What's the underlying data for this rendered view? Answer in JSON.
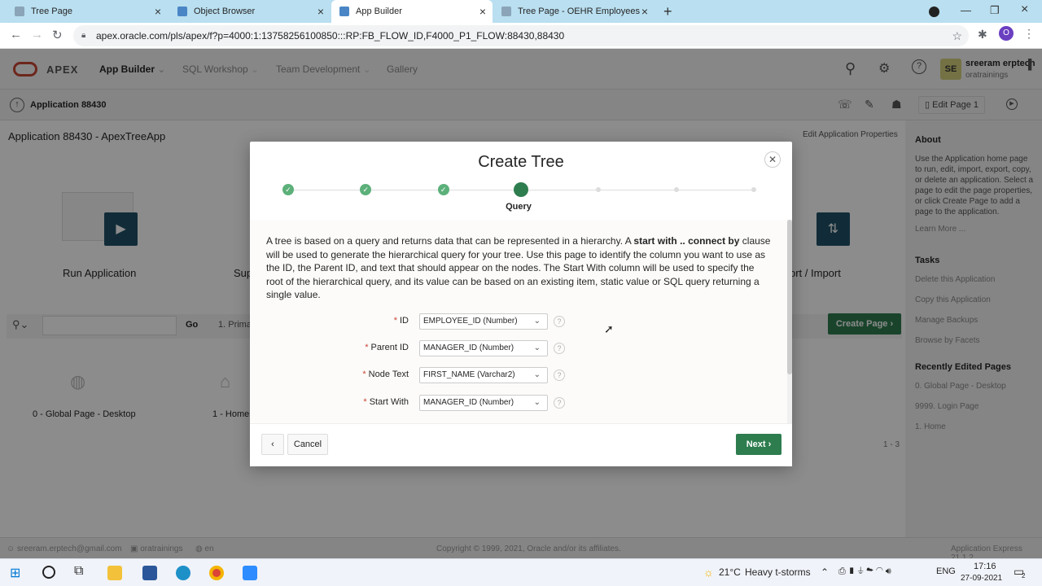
{
  "browser": {
    "tabs": [
      {
        "title": "Tree Page",
        "active": false
      },
      {
        "title": "Object Browser",
        "active": false
      },
      {
        "title": "App Builder",
        "active": true
      },
      {
        "title": "Tree Page - OEHR Employees",
        "active": false
      }
    ],
    "new_tab": "+",
    "url": "apex.oracle.com/pls/apex/f?p=4000:1:13758256100850:::RP:FB_FLOW_ID,F4000_P1_FLOW:88430,88430",
    "profile_initial": "O"
  },
  "apex_header": {
    "brand": "APEX",
    "menus": [
      "App Builder",
      "SQL Workshop",
      "Team Development",
      "Gallery"
    ],
    "user_initials": "SE",
    "user_name": "sreeram erptech",
    "user_org": "oratrainings"
  },
  "app_bar": {
    "app_label": "Application 88430",
    "edit_page": "Edit Page 1"
  },
  "background_page": {
    "title": "Application 88430 - ApexTreeApp",
    "edit_props": "Edit Application Properties",
    "tiles": [
      "Run Application",
      "Sup",
      "ort / Import"
    ],
    "search_go": "Go",
    "search_filter": "1. Prima",
    "create_page": "Create Page",
    "pages": [
      "0 - Global Page - Desktop",
      "1 - Home"
    ],
    "pagination": "1 - 3"
  },
  "right_panel": {
    "about_title": "About",
    "about_text": "Use the Application home page to run, edit, import, export, copy, or delete an application. Select a page to edit the page properties, or click Create Page to add a page to the application.",
    "learn_more": "Learn More ...",
    "tasks_title": "Tasks",
    "tasks": [
      "Delete this Application",
      "Copy this Application",
      "Manage Backups",
      "Browse by Facets"
    ],
    "recent_title": "Recently Edited Pages",
    "recent": [
      "0. Global Page - Desktop",
      "9999. Login Page",
      "1. Home"
    ]
  },
  "footer": {
    "email": "sreeram.erptech@gmail.com",
    "workspace": "oratrainings",
    "lang": "en",
    "copyright": "Copyright © 1999, 2021, Oracle and/or its affiliates.",
    "version": "Application Express 21.1.2"
  },
  "dialog": {
    "title": "Create Tree",
    "current_step_label": "Query",
    "steps_completed": 3,
    "steps_total": 7,
    "description_pre": "A tree is based on a query and returns data that can be represented in a hierarchy. A ",
    "description_bold": "start with .. connect by",
    "description_post": " clause will be used to generate the hierarchical query for your tree. Use this page to identify the column you want to use as the ID, the Parent ID, and text that should appear on the nodes. The Start With column will be used to specify the root of the hierarchical query, and its value can be based on an existing item, static value or SQL query returning a single value.",
    "fields": [
      {
        "label": "ID",
        "value": "EMPLOYEE_ID (Number)"
      },
      {
        "label": "Parent ID",
        "value": "MANAGER_ID (Number)"
      },
      {
        "label": "Node Text",
        "value": "FIRST_NAME (Varchar2)"
      },
      {
        "label": "Start With",
        "value": "MANAGER_ID (Number)"
      }
    ],
    "required_mark": "*",
    "help_mark": "?",
    "prev_label": "‹",
    "cancel_label": "Cancel",
    "next_label": "Next ›"
  },
  "taskbar": {
    "weather_temp": "21°C",
    "weather_text": "Heavy t-storms",
    "lang": "ENG",
    "time": "17:16",
    "date": "27-09-2021",
    "notifications": "2"
  },
  "colors": {
    "accent_green": "#2e7d4f",
    "step_done": "#5cb07a",
    "oracle_red": "#c74634",
    "tab_bar": "#b9dff0"
  }
}
